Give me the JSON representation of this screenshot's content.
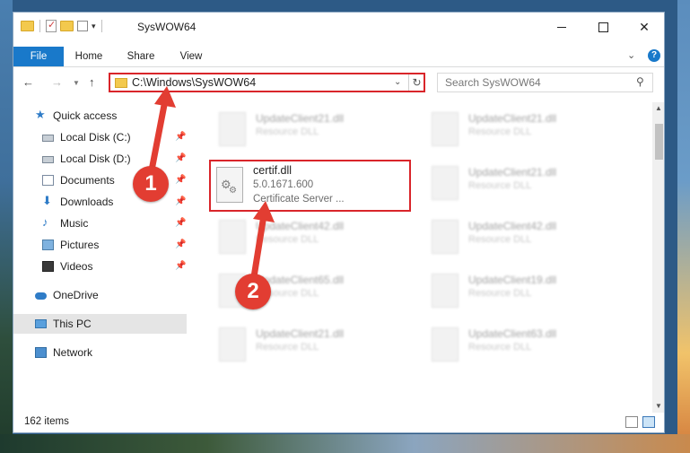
{
  "window": {
    "title": "SysWOW64",
    "controls": {
      "minimize": "–",
      "maximize": "□",
      "close": "✕"
    }
  },
  "ribbon": {
    "tabs": [
      {
        "label": "File"
      },
      {
        "label": "Home"
      },
      {
        "label": "Share"
      },
      {
        "label": "View"
      }
    ],
    "help": "?"
  },
  "address": {
    "path": "C:\\Windows\\SysWOW64",
    "search_placeholder": "Search SysWOW64"
  },
  "sidebar": {
    "quick_access": "Quick access",
    "pinned": [
      {
        "label": "Local Disk (C:)",
        "icon": "drive-icon"
      },
      {
        "label": "Local Disk (D:)",
        "icon": "drive-icon"
      },
      {
        "label": "Documents",
        "icon": "documents-icon"
      },
      {
        "label": "Downloads",
        "icon": "downloads-icon"
      },
      {
        "label": "Music",
        "icon": "music-icon"
      },
      {
        "label": "Pictures",
        "icon": "pictures-icon"
      },
      {
        "label": "Videos",
        "icon": "videos-icon"
      }
    ],
    "onedrive": "OneDrive",
    "this_pc": "This PC",
    "network": "Network"
  },
  "files": {
    "blurred": [
      {
        "name": "UpdateClient21.dll",
        "desc": "Resource DLL"
      },
      {
        "name": "UpdateClient21.dll",
        "desc": "Resource DLL"
      },
      {
        "name": "UpdateClient21.dll",
        "desc": "Resource DLL"
      },
      {
        "name": "UpdateClient42.dll",
        "desc": "Resource DLL"
      },
      {
        "name": "UpdateClient42.dll",
        "desc": "Resource DLL"
      },
      {
        "name": "UpdateClient65.dll",
        "desc": "Resource DLL"
      },
      {
        "name": "UpdateClient19.dll",
        "desc": "Resource DLL"
      },
      {
        "name": "UpdateClient21.dll",
        "desc": "Resource DLL"
      },
      {
        "name": "UpdateClient63.dll",
        "desc": "Resource DLL"
      }
    ],
    "target": {
      "name": "certif.dll",
      "version": "5.0.1671.600",
      "description": "Certificate Server ..."
    }
  },
  "status": {
    "item_count": "162 items"
  },
  "annotations": {
    "badge_1": "1",
    "badge_2": "2",
    "color": "#e23d32"
  }
}
